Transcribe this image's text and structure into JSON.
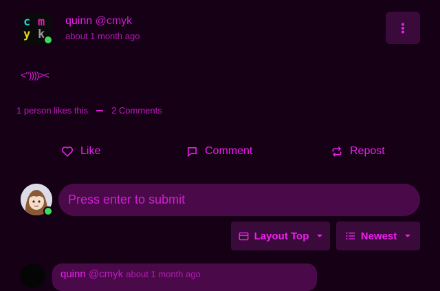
{
  "post": {
    "author_name": "quinn",
    "author_handle": "@cmyk",
    "time": "about 1 month ago",
    "avatar_letters": [
      "c",
      "m",
      "y",
      "k"
    ],
    "body": "<°))))><",
    "likes_text": "1 person likes this",
    "comments_text": "2 Comments"
  },
  "actions": {
    "like_label": "Like",
    "comment_label": "Comment",
    "repost_label": "Repost"
  },
  "composer": {
    "placeholder": "Press enter to submit"
  },
  "controls": {
    "layout_label": "Layout Top",
    "sort_label": "Newest"
  },
  "first_comment": {
    "author_name": "quinn",
    "author_handle": "@cmyk",
    "time": "about 1 month ago"
  },
  "colors": {
    "background": "#150015",
    "accent": "#f020f0",
    "surface": "#3a0a3a",
    "input": "#4a0a4a",
    "online": "#3ddc58"
  },
  "icons": [
    "kebab-menu-icon",
    "heart-icon",
    "comment-bubble-icon",
    "repost-icon",
    "layout-icon",
    "sort-list-icon",
    "chevron-down-icon",
    "fish-emoticon"
  ]
}
